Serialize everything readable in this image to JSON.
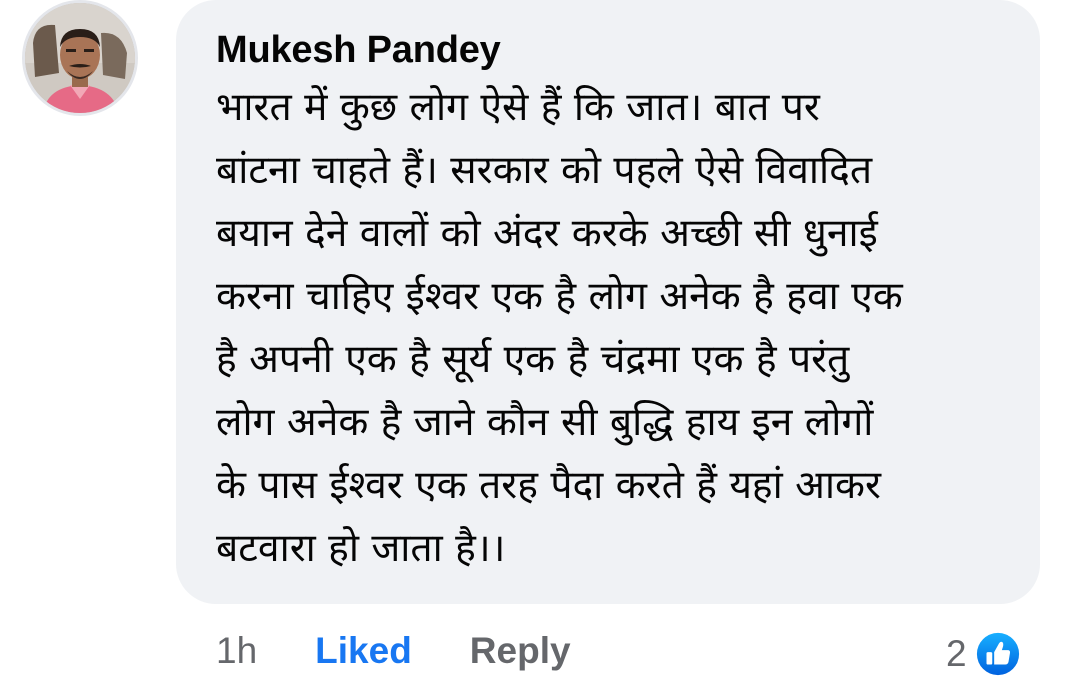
{
  "comment": {
    "author": "Mukesh Pandey",
    "avatar_icon": "user-avatar",
    "lines": [
      "भारत में कुछ लोग ऐसे हैं कि जात।  बात पर",
      "बांटना चाहते हैं। सरकार को पहले ऐसे विवादित",
      "बयान देने वालों को अंदर करके अच्छी सी धुनाई",
      "करना चाहिए ईश्वर एक है लोग अनेक है हवा एक",
      "है अपनी एक है सूर्य एक है चंद्रमा एक है परंतु",
      "लोग अनेक है जाने कौन सी बुद्धि हाय  इन लोगों",
      "के पास ईश्वर एक तरह पैदा करते हैं यहां आकर",
      "बटवारा हो जाता है।।"
    ]
  },
  "actions": {
    "time": "1h",
    "like_label": "Liked",
    "reply_label": "Reply"
  },
  "reactions": {
    "count": "2",
    "icon": "thumbs-up-icon"
  },
  "colors": {
    "bubble_bg": "#f0f2f5",
    "liked_blue": "#1877f2",
    "meta_gray": "#65676b",
    "text": "#050505"
  }
}
